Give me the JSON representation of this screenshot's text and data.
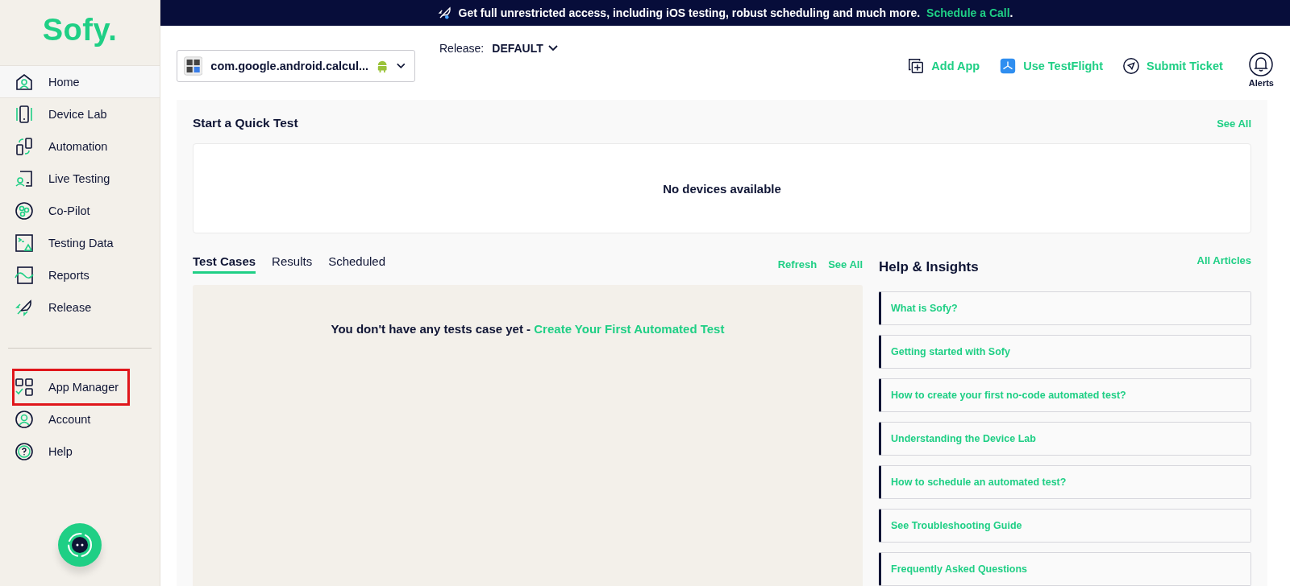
{
  "logo": "Sofy.",
  "sidebar": {
    "items": [
      {
        "label": "Home",
        "kind": "home",
        "selected": true,
        "highlighted": false
      },
      {
        "label": "Device Lab",
        "kind": "device",
        "selected": false,
        "highlighted": false
      },
      {
        "label": "Automation",
        "kind": "automation",
        "selected": false,
        "highlighted": false
      },
      {
        "label": "Live Testing",
        "kind": "live",
        "selected": false,
        "highlighted": false
      },
      {
        "label": "Co-Pilot",
        "kind": "copilot",
        "selected": false,
        "highlighted": false
      },
      {
        "label": "Testing Data",
        "kind": "data",
        "selected": false,
        "highlighted": false
      },
      {
        "label": "Reports",
        "kind": "reports",
        "selected": false,
        "highlighted": false
      },
      {
        "label": "Release",
        "kind": "release",
        "selected": false,
        "highlighted": false
      }
    ],
    "bottom_items": [
      {
        "label": "App Manager",
        "kind": "apps",
        "selected": false,
        "highlighted": true
      },
      {
        "label": "Account",
        "kind": "account",
        "selected": false,
        "highlighted": false
      },
      {
        "label": "Help",
        "kind": "help",
        "selected": false,
        "highlighted": false
      }
    ]
  },
  "banner": {
    "text": "Get full unrestricted access, including iOS testing, robust scheduling and much more.",
    "link": "Schedule a Call",
    "suffix": "."
  },
  "app_selector": {
    "value": "com.google.android.calcul..."
  },
  "release": {
    "label": "Release:",
    "value": "DEFAULT"
  },
  "actions": [
    {
      "label": "Add App",
      "kind": "add"
    },
    {
      "label": "Use TestFlight",
      "kind": "testflight"
    },
    {
      "label": "Submit Ticket",
      "kind": "ticket"
    }
  ],
  "alerts": {
    "label": "Alerts"
  },
  "quick_test": {
    "title": "Start a Quick Test",
    "link": "See All",
    "empty": "No devices available"
  },
  "tabs": [
    {
      "label": "Test Cases",
      "selected": true
    },
    {
      "label": "Results",
      "selected": false
    },
    {
      "label": "Scheduled",
      "selected": false
    }
  ],
  "tab_links": [
    "Refresh",
    "See All"
  ],
  "tests_empty": {
    "text": "You don't have any tests case yet - ",
    "link": "Create Your First Automated Test"
  },
  "help": {
    "title": "Help & Insights",
    "link": "All Articles",
    "articles": [
      "What is Sofy?",
      "Getting started with Sofy",
      "How to create your first no-code automated test?",
      "Understanding the Device Lab",
      "How to schedule an automated test?",
      "See Troubleshooting Guide",
      "Frequently Asked Questions"
    ]
  }
}
